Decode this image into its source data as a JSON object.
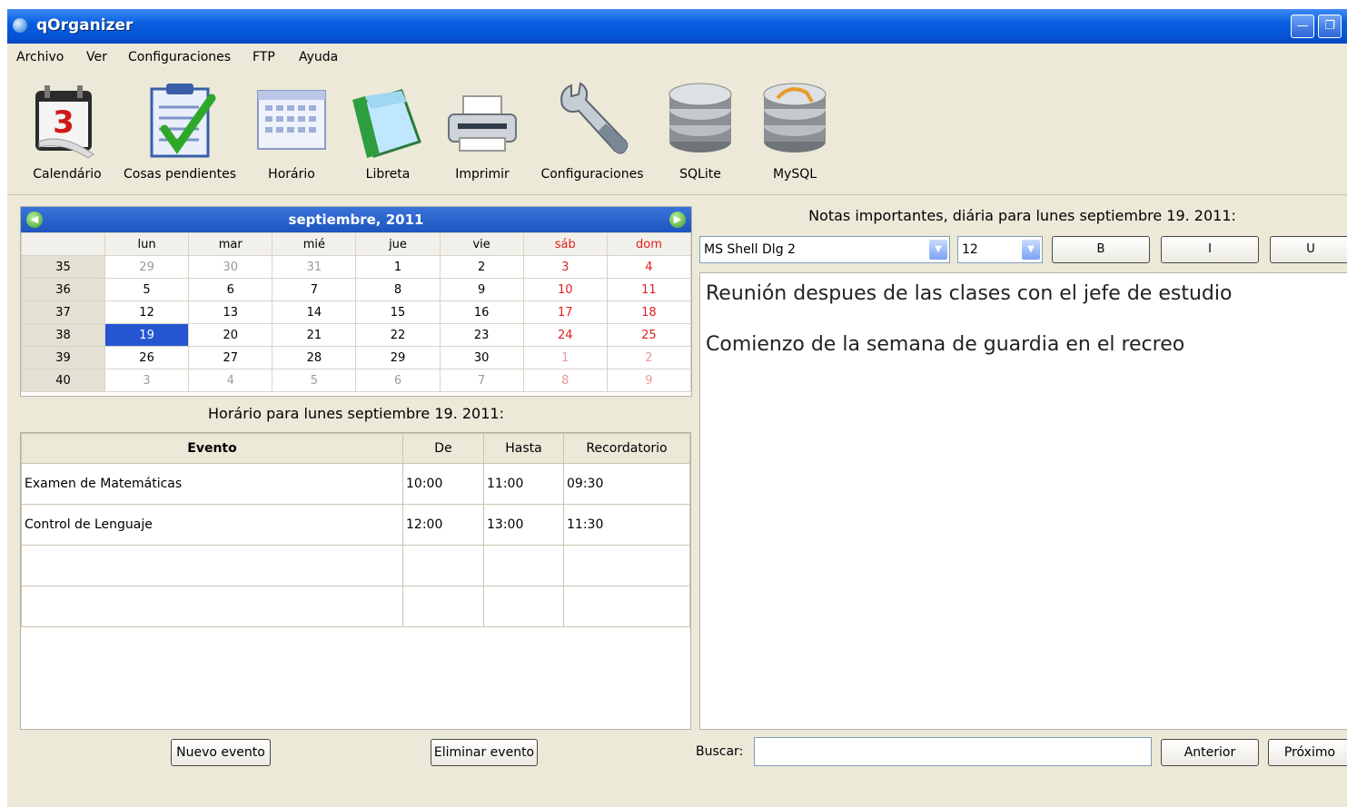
{
  "window": {
    "title": "qOrganizer"
  },
  "menu": [
    "Archivo",
    "Ver",
    "Configuraciones",
    "FTP",
    "Ayuda"
  ],
  "toolbar": [
    {
      "label": "Calendário",
      "icon": "calendar-icon"
    },
    {
      "label": "Cosas pendientes",
      "icon": "todo-checklist-icon"
    },
    {
      "label": "Horário",
      "icon": "schedule-grid-icon"
    },
    {
      "label": "Libreta",
      "icon": "notebook-icon"
    },
    {
      "label": "Imprimir",
      "icon": "printer-icon"
    },
    {
      "label": "Configuraciones",
      "icon": "wrench-icon"
    },
    {
      "label": "SQLite",
      "icon": "database-icon"
    },
    {
      "label": "MySQL",
      "icon": "database-icon"
    }
  ],
  "calendar": {
    "month_title": "septiembre,  2011",
    "weekdays": [
      "lun",
      "mar",
      "mié",
      "jue",
      "vie",
      "sáb",
      "dom"
    ],
    "weeks": [
      {
        "num": "35",
        "days": [
          "29",
          "30",
          "31",
          "1",
          "2",
          "3",
          "4"
        ]
      },
      {
        "num": "36",
        "days": [
          "5",
          "6",
          "7",
          "8",
          "9",
          "10",
          "11"
        ]
      },
      {
        "num": "37",
        "days": [
          "12",
          "13",
          "14",
          "15",
          "16",
          "17",
          "18"
        ]
      },
      {
        "num": "38",
        "days": [
          "19",
          "20",
          "21",
          "22",
          "23",
          "24",
          "25"
        ]
      },
      {
        "num": "39",
        "days": [
          "26",
          "27",
          "28",
          "29",
          "30",
          "1",
          "2"
        ]
      },
      {
        "num": "40",
        "days": [
          "3",
          "4",
          "5",
          "6",
          "7",
          "8",
          "9"
        ]
      }
    ],
    "selected": "19"
  },
  "schedule": {
    "title": "Horário para lunes septiembre 19. 2011:",
    "columns": [
      "Evento",
      "De",
      "Hasta",
      "Recordatorio"
    ],
    "rows": [
      [
        "Examen de Matemáticas",
        "10:00",
        "11:00",
        "09:30"
      ],
      [
        "Control de Lenguaje",
        "12:00",
        "13:00",
        "11:30"
      ],
      [
        "",
        "",
        "",
        ""
      ],
      [
        "",
        "",
        "",
        ""
      ]
    ],
    "new_button": "Nuevo evento",
    "delete_button": "Eliminar evento"
  },
  "notes": {
    "title": "Notas importantes, diária para lunes septiembre 19. 2011:",
    "font": "MS Shell Dlg 2",
    "size": "12",
    "bold": "B",
    "italic": "I",
    "underline": "U",
    "lines": [
      "Reunión despues de las clases con el jefe de estudio",
      "Comienzo de la semana de guardia en el recreo"
    ]
  },
  "search": {
    "label": "Buscar:",
    "value": "",
    "prev": "Anterior",
    "next": "Próximo"
  },
  "colors": {
    "titlebar": "#0553d6",
    "selected_day": "#2655d0",
    "weekend": "#e02020",
    "window_bg": "#ece9d8"
  }
}
